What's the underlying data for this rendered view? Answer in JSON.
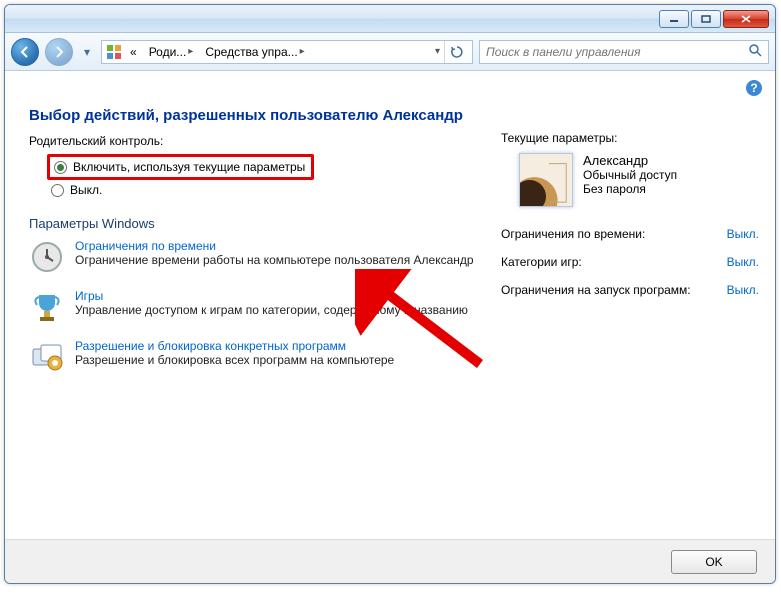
{
  "breadcrumb": {
    "prefix": "«",
    "level1": "Роди...",
    "level2": "Средства упра..."
  },
  "search": {
    "placeholder": "Поиск в панели управления"
  },
  "page": {
    "title": "Выбор действий, разрешенных пользователю Александр"
  },
  "parental": {
    "label": "Родительский контроль:",
    "on_label": "Включить, используя текущие параметры",
    "off_label": "Выкл."
  },
  "params_header": "Параметры Windows",
  "options": {
    "time": {
      "link": "Ограничения по времени",
      "desc": "Ограничение времени работы на компьютере пользователя Александр"
    },
    "games": {
      "link": "Игры",
      "desc": "Управление доступом к играм по категории, содержимому и названию"
    },
    "apps": {
      "link": "Разрешение и блокировка конкретных программ",
      "desc": "Разрешение и блокировка всех программ на компьютере"
    }
  },
  "right": {
    "label": "Текущие параметры:",
    "user_name": "Александр",
    "user_role": "Обычный доступ",
    "user_password": "Без пароля",
    "rows": {
      "time_label": "Ограничения по времени:",
      "time_value": "Выкл.",
      "games_label": "Категории игр:",
      "games_value": "Выкл.",
      "apps_label": "Ограничения на запуск программ:",
      "apps_value": "Выкл."
    }
  },
  "footer": {
    "ok": "OK"
  },
  "colors": {
    "highlight": "#e40000",
    "link": "#0066cc",
    "title": "#003399"
  }
}
